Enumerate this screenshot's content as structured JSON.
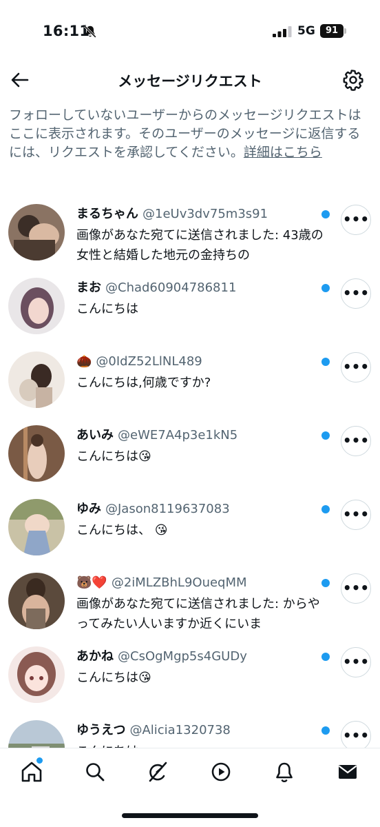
{
  "status_bar": {
    "time": "16:11",
    "network": "5G",
    "battery": "91",
    "icons": [
      "bell-slash-icon",
      "signal-icon",
      "battery-icon"
    ]
  },
  "header": {
    "title": "メッセージリクエスト",
    "back_icon": "arrow-left-icon",
    "settings_icon": "gear-icon"
  },
  "info": {
    "text": "フォローしていないユーザーからのメッセージリクエストはここに表示されます。そのユーザーのメッセージに返信するには、リクエストを承認してください。",
    "link_label": "詳細はこちら"
  },
  "requests": [
    {
      "name": "まるちゃん",
      "handle": "@1eUv3dv75m3s91",
      "message": "画像があなた宛てに送信されました: 43歳の女性と結婚した地元の金持ちの",
      "unread": true
    },
    {
      "name": "まお",
      "handle": "@Chad60904786811",
      "message": "こんにちは",
      "unread": true
    },
    {
      "name": "🌰",
      "handle": "@0IdZ52LlNL489",
      "message": "こんにちは,何歳ですか?",
      "unread": true
    },
    {
      "name": "あいみ",
      "handle": "@eWE7A4p3e1kN5",
      "message": "こんにちは😘",
      "unread": true
    },
    {
      "name": "ゆみ",
      "handle": "@Jason8119637083",
      "message": "こんにちは、 😘",
      "unread": true
    },
    {
      "name": "🐻❤️",
      "handle": "@2iMLZBhL9OueqMM",
      "message": "画像があなた宛てに送信されました: からやってみたい人いますか近くにいま",
      "unread": true
    },
    {
      "name": "あかね",
      "handle": "@CsOgMgp5s4GUDy",
      "message": "こんにちは😘",
      "unread": true
    },
    {
      "name": "ゆうえつ",
      "handle": "@Alicia1320738",
      "message": "こんにちは",
      "unread": true
    }
  ],
  "more_label": "•••",
  "tab_bar": {
    "tabs": [
      "home-icon",
      "search-icon",
      "grok-icon",
      "video-icon",
      "bell-icon",
      "mail-icon"
    ],
    "home_has_notification": true
  },
  "colors": {
    "accent": "#1d9bf0",
    "secondary_text": "#536471",
    "primary_text": "#0f1419"
  }
}
